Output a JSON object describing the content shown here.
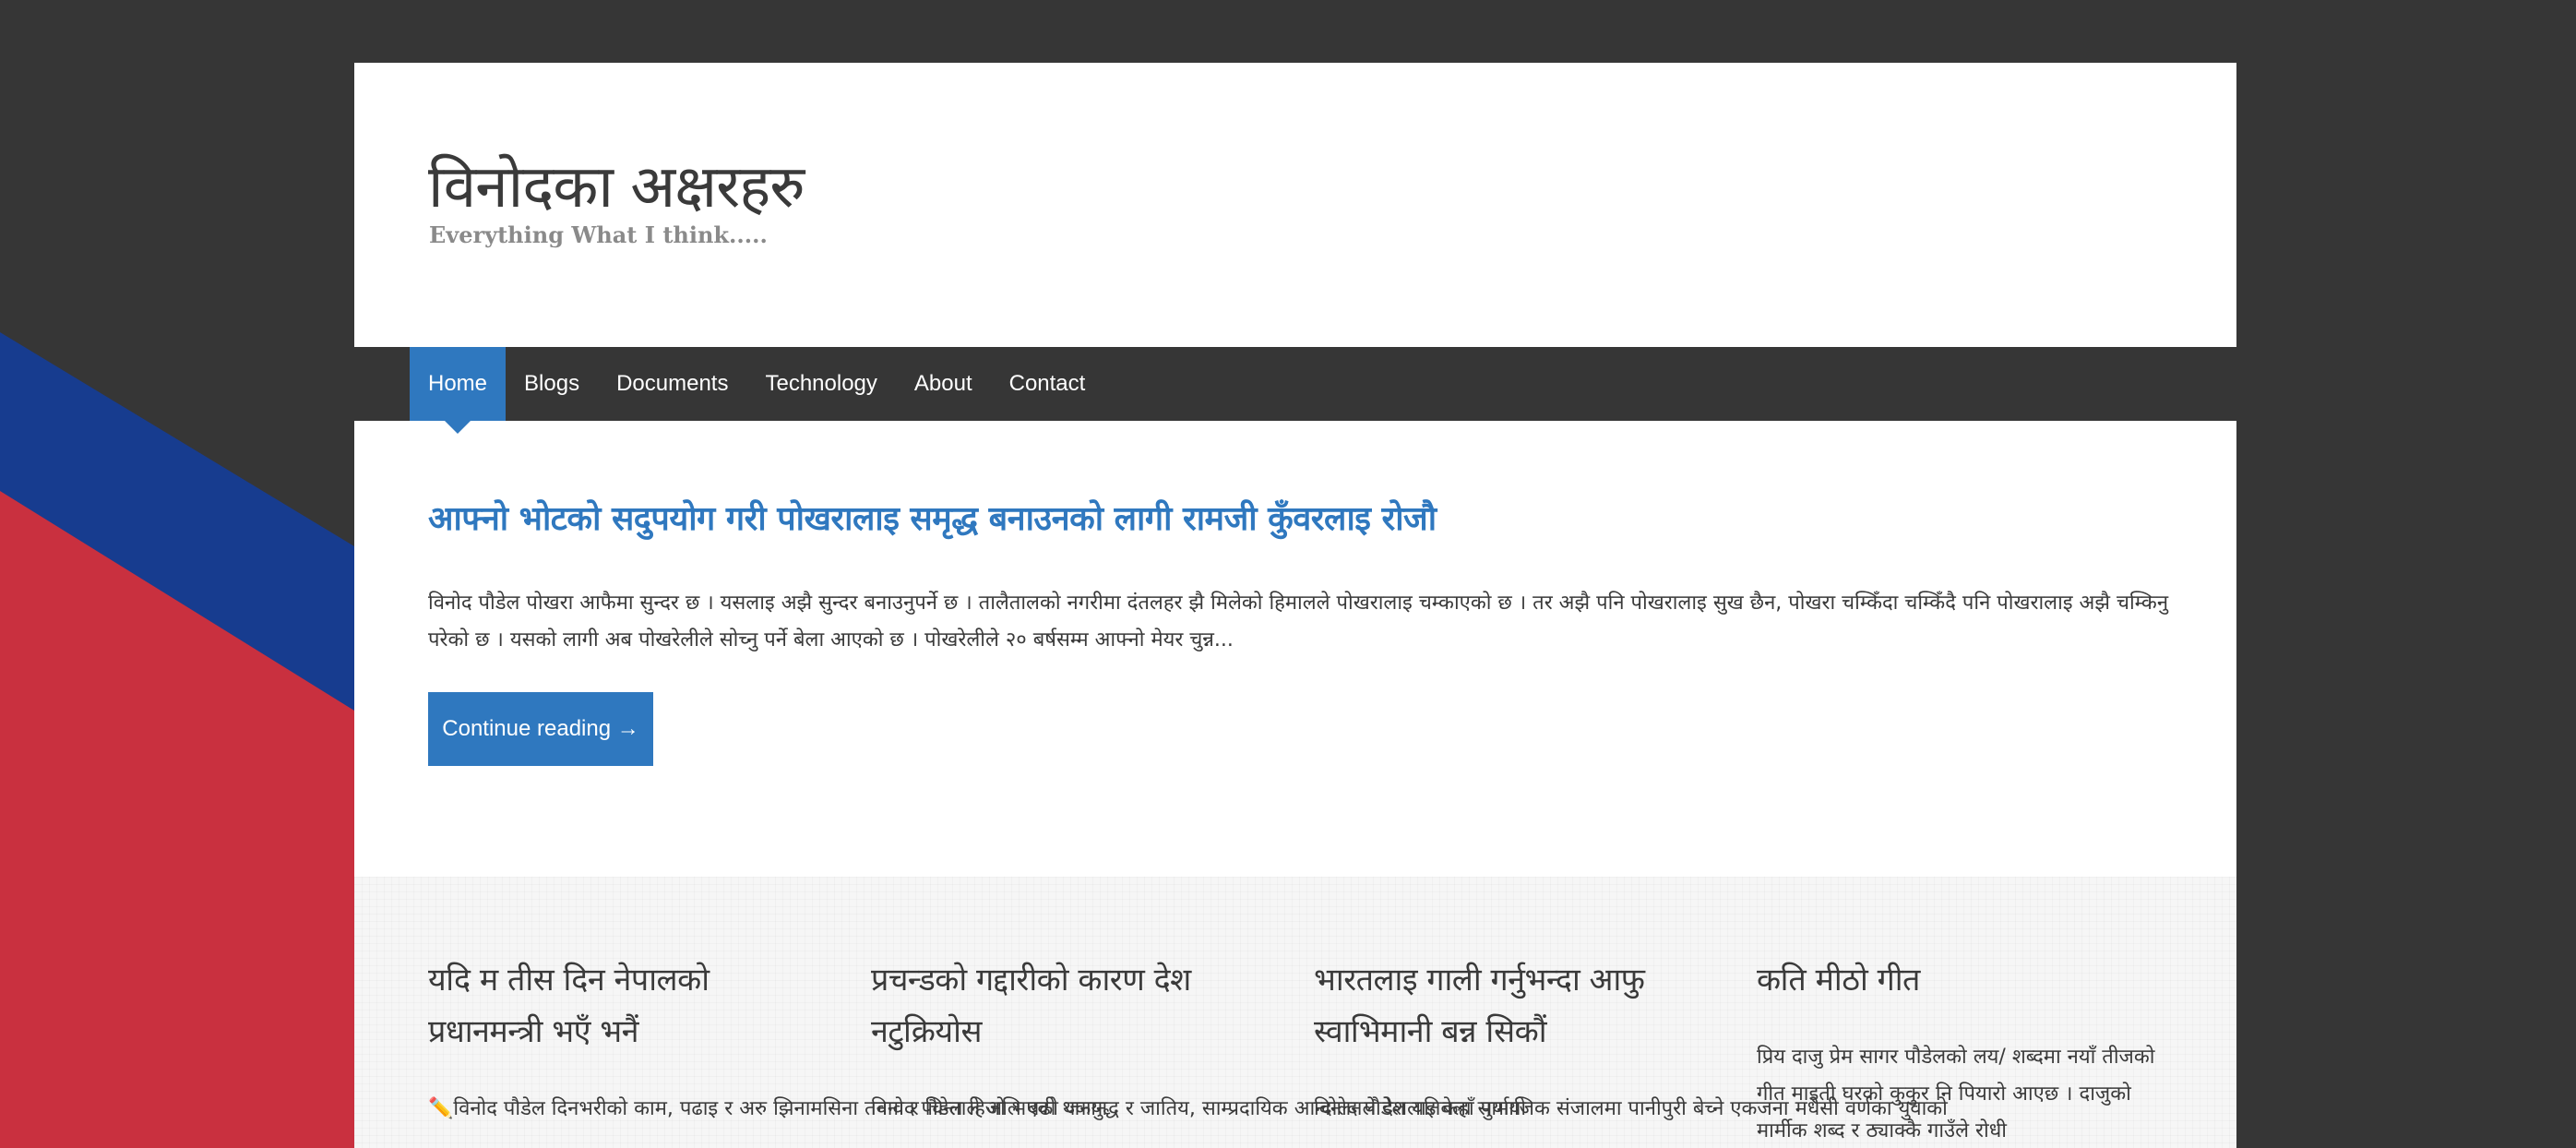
{
  "site": {
    "title": "विनोदका अक्षरहरु",
    "tagline": "Everything What I think....."
  },
  "nav": {
    "items": [
      "Home",
      "Blogs",
      "Documents",
      "Technology",
      "About",
      "Contact"
    ],
    "active": "Home"
  },
  "featured": {
    "title": "आफ्नो भोटको सदुपयोग गरी पोखरालाइ समृद्ध बनाउनको लागी रामजी कुँवरलाइ रोजौ",
    "excerpt": "विनोद पौडेल पोखरा आफैमा सुन्दर छ । यसलाइ अझै सुन्दर बनाउनुपर्ने छ । तालैतालको नगरीमा दंतलहर झै मिलेको हिमालले पोखरालाइ चम्काएको छ । तर अझै पनि पोखरालाइ सुख छैन, पोखरा चम्किँदा चम्किँदै पनि पोखरालाइ अझै चम्किनु परेको छ । यसको लागी अब पोखरेलीले सोच्नु पर्ने बेला आएको छ । पोखरेलीले २० बर्षसम्म आफ्नो मेयर चुन्न...",
    "button": "Continue reading →"
  },
  "posts": [
    {
      "title": "यदि म तीस दिन नेपालको प्रधानमन्त्री भएँ भनैं",
      "excerpt": "✏️विनोद पौडेल दिनभरीको काम, पढाइ र अरु झिनामसिना तनाव र चिन्ताले अलि बढी थकान"
    },
    {
      "title": "प्रचन्डको गद्दारीको कारण देश नटुक्रियोस",
      "excerpt": "विनोद पौडेल हिजो भएको जनयुद्ध र जातिय, साम्प्रदायिक आन्दोलनले देशलाइ कहाँ पुर्यायो"
    },
    {
      "title": "भारतलाइ गाली गर्नुभन्दा आफु स्वाभिमानी बन्न सिकौं",
      "excerpt": "विनोद पौडेल यतिबेला सामाजिक संजालमा पानीपुरी बेच्ने एकजना मधेसी वर्णका युवाको"
    },
    {
      "title": "कति मीठो गीत",
      "excerpt": " प्रिय दाजु प्रेम सागर पौडेलको लय/ शब्दमा नयाँ तीजको गीत माइती घरको कुकुर नि पियारो आएछ । दाजुको मार्मीक शब्द र ठ्याक्कै गाउँले रोधी"
    }
  ],
  "colors": {
    "accent": "#2f78bf",
    "nav_bg": "#363636",
    "outer_bg": "#363636",
    "stripe_blue": "#173c8f",
    "stripe_red": "#c9303f"
  }
}
